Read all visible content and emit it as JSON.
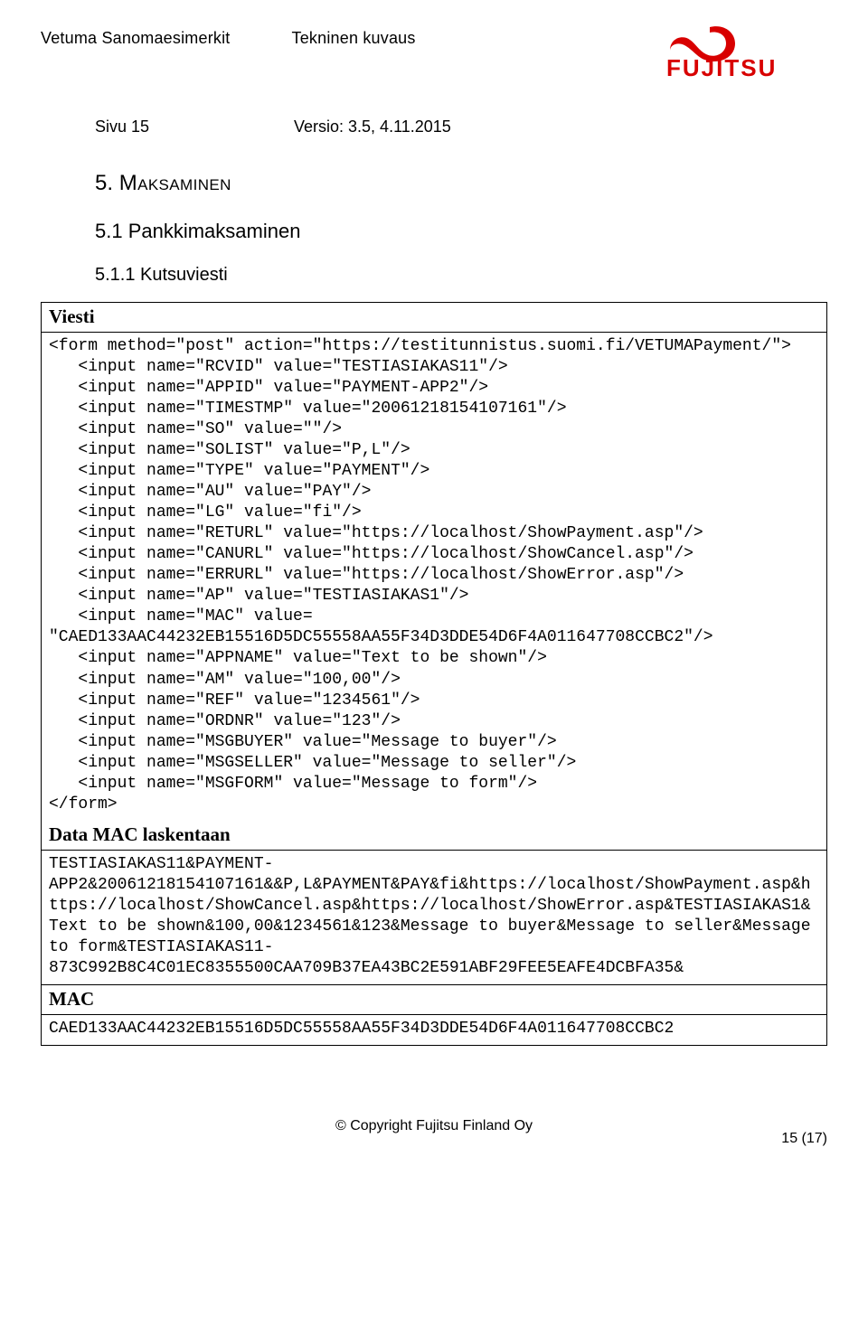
{
  "header": {
    "title_left": "Vetuma Sanomaesimerkit",
    "title_mid": "Tekninen kuvaus",
    "logo_text": "FUJITSU"
  },
  "meta": {
    "page_label": "Sivu 15",
    "version_label": "Versio: 3.5, 4.11.2015"
  },
  "sections": {
    "h1_num": "5.",
    "h1_text": "Maksaminen",
    "h2": "5.1 Pankkimaksaminen",
    "h3": "5.1.1 Kutsuviesti"
  },
  "box": {
    "label_viesti": "Viesti",
    "code": {
      "form_open": "<form method=\"post\" action=\"https://testitunnistus.suomi.fi/VETUMAPayment/\">",
      "inputs": [
        "<input name=\"RCVID\" value=\"TESTIASIAKAS11\"/>",
        "<input name=\"APPID\" value=\"PAYMENT-APP2\"/>",
        "<input name=\"TIMESTMP\" value=\"20061218154107161\"/>",
        "<input name=\"SO\" value=\"\"/>",
        "<input name=\"SOLIST\" value=\"P,L\"/>",
        "<input name=\"TYPE\" value=\"PAYMENT\"/>",
        "<input name=\"AU\" value=\"PAY\"/>",
        "<input name=\"LG\" value=\"fi\"/>",
        "<input name=\"RETURL\" value=\"https://localhost/ShowPayment.asp\"/>",
        "<input name=\"CANURL\" value=\"https://localhost/ShowCancel.asp\"/>",
        "<input name=\"ERRURL\" value=\"https://localhost/ShowError.asp\"/>",
        "<input name=\"AP\" value=\"TESTIASIAKAS1\"/>",
        "<input name=\"MAC\" value=",
        "\"CAED133AAC44232EB15516D5DC55558AA55F34D3DDE54D6F4A011647708CCBC2\"/>",
        "<input name=\"APPNAME\" value=\"Text to be shown\"/>",
        "<input name=\"AM\" value=\"100,00\"/>",
        "<input name=\"REF\" value=\"1234561\"/>",
        "<input name=\"ORDNR\" value=\"123\"/>",
        "<input name=\"MSGBUYER\" value=\"Message to buyer\"/>",
        "<input name=\"MSGSELLER\" value=\"Message to seller\"/>",
        "<input name=\"MSGFORM\" value=\"Message to form\"/>"
      ],
      "form_close": "</form>"
    },
    "label_data": "Data MAC laskentaan",
    "data_mac": "TESTIASIAKAS11&PAYMENT-APP2&20061218154107161&&P,L&PAYMENT&PAY&fi&https://localhost/ShowPayment.asp&https://localhost/ShowCancel.asp&https://localhost/ShowError.asp&TESTIASIAKAS1&Text to be shown&100,00&1234561&123&Message to buyer&Message to seller&Message to form&TESTIASIAKAS11-873C992B8C4C01EC8355500CAA709B37EA43BC2E591ABF29FEE5EAFE4DCBFA35&",
    "label_mac": "MAC",
    "mac_value": "CAED133AAC44232EB15516D5DC55558AA55F34D3DDE54D6F4A011647708CCBC2"
  },
  "footer": {
    "copyright": "© Copyright Fujitsu Finland Oy",
    "page_num": "15 (17)"
  }
}
